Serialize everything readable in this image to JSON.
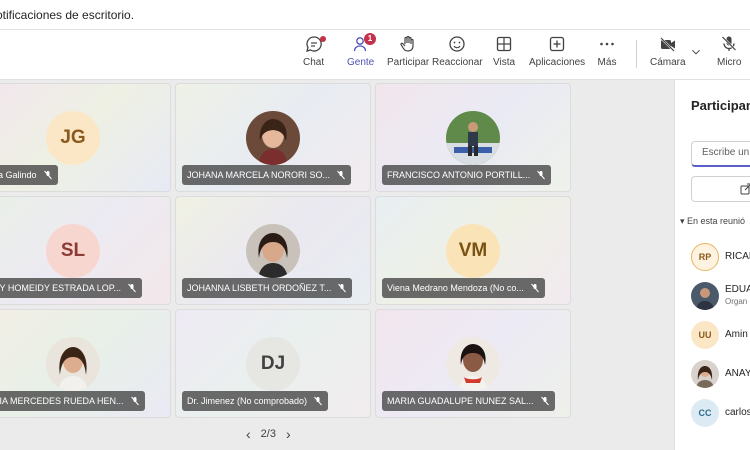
{
  "notification": {
    "text": "otificaciones de escritorio."
  },
  "toolbar": {
    "chat": "Chat",
    "people": "Gente",
    "people_badge": "1",
    "raise": "Participar",
    "react": "Reaccionar",
    "view": "Vista",
    "apps": "Aplicaciones",
    "more": "Más",
    "camera": "Cámara",
    "mic": "Micro"
  },
  "tiles": [
    {
      "initials": "JG",
      "name": "sica Galindo"
    },
    {
      "initials": "",
      "name": "JOHANA MARCELA NORORI SO..."
    },
    {
      "initials": "",
      "name": "FRANCISCO ANTONIO PORTILL..."
    },
    {
      "initials": "SL",
      "name": "ANY HOMEIDY ESTRADA LOP..."
    },
    {
      "initials": "",
      "name": "JOHANNA LISBETH ORDOÑEZ T..."
    },
    {
      "initials": "VM",
      "name": "Viena Medrano Mendoza (No co..."
    },
    {
      "initials": "",
      "name": "ARIA MERCEDES RUEDA HEN..."
    },
    {
      "initials": "DJ",
      "name": "Dr. Jimenez (No comprobado)"
    },
    {
      "initials": "",
      "name": "MARIA GUADALUPE NUNEZ SAL..."
    }
  ],
  "pager": {
    "text": "2/3"
  },
  "panel": {
    "title": "Participantes",
    "search_placeholder": "Escribe un",
    "section": "▾ En esta reunió",
    "participants": [
      {
        "initials": "RP",
        "name": "RICAR",
        "sub": ""
      },
      {
        "initials": "",
        "name": "EDUA",
        "sub": "Organ"
      },
      {
        "initials": "UU",
        "name": "Amin",
        "sub": ""
      },
      {
        "initials": "",
        "name": "ANAY",
        "sub": ""
      },
      {
        "initials": "CC",
        "name": "carlos",
        "sub": ""
      }
    ]
  },
  "colors": {
    "accent": "#5b5fc7",
    "badge": "#c4314b"
  }
}
